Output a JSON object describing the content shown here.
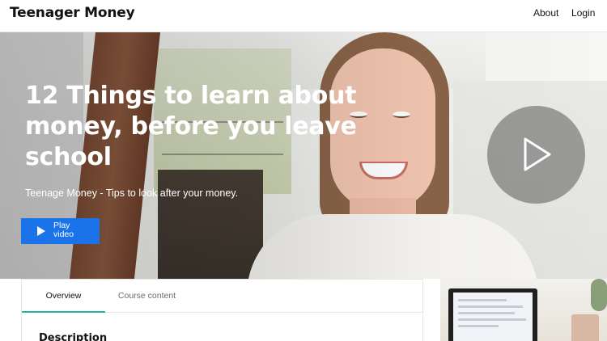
{
  "header": {
    "brand": "Teenager Money",
    "nav": {
      "about": "About",
      "login": "Login"
    }
  },
  "hero": {
    "title": "12 Things to learn about money, before you leave school",
    "subtitle": "Teenage Money - Tips to  look after your money.",
    "play_button_label": "Play video",
    "play_overlay_icon": "play-icon"
  },
  "content": {
    "tabs": [
      {
        "label": "Overview",
        "active": true
      },
      {
        "label": "Course content",
        "active": false
      }
    ],
    "section_heading": "Description"
  },
  "colors": {
    "accent_button": "#1a73e8",
    "active_tab_underline": "#22b3a3"
  }
}
